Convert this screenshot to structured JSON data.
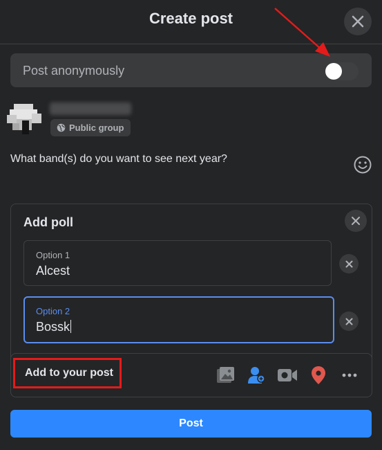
{
  "header": {
    "title": "Create post",
    "close_icon": "close-icon"
  },
  "anonymous": {
    "label": "Post anonymously",
    "toggle_on": false
  },
  "author": {
    "badge_icon": "globe-icon",
    "badge_label": "Public group"
  },
  "composer": {
    "text": "What band(s) do you want to see next year?",
    "emoji_icon": "smiley-icon"
  },
  "poll": {
    "title": "Add poll",
    "options": [
      {
        "label": "Option 1",
        "value": "Alcest"
      },
      {
        "label": "Option 2",
        "value": "Bossk"
      }
    ]
  },
  "add_to_post": {
    "label": "Add to your post",
    "tools": [
      "photo-video-icon",
      "tag-people-icon",
      "live-video-icon",
      "location-icon",
      "more-icon"
    ]
  },
  "post_button": {
    "label": "Post"
  },
  "colors": {
    "background": "#242526",
    "surface": "#3a3b3c",
    "accent": "#2d88ff",
    "focus": "#5b8dee",
    "annotation": "#e41b1b",
    "location": "#e0574d",
    "tag": "#3b8ef0"
  }
}
